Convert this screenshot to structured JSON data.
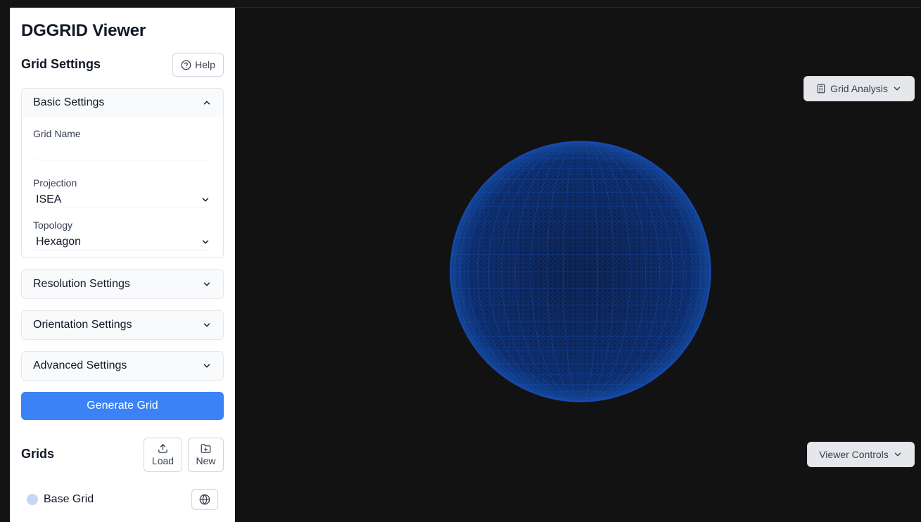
{
  "app": {
    "title": "DGGRID Viewer"
  },
  "grid_settings": {
    "title": "Grid Settings",
    "help_label": "Help",
    "panels": {
      "basic": {
        "label": "Basic Settings",
        "grid_name": {
          "label": "Grid Name",
          "value": "",
          "placeholder": ""
        },
        "projection": {
          "label": "Projection",
          "value": "ISEA"
        },
        "topology": {
          "label": "Topology",
          "value": "Hexagon"
        }
      },
      "resolution": {
        "label": "Resolution Settings"
      },
      "orientation": {
        "label": "Orientation Settings"
      },
      "advanced": {
        "label": "Advanced Settings"
      }
    },
    "generate_label": "Generate Grid"
  },
  "grids": {
    "title": "Grids",
    "load_label": "Load",
    "new_label": "New",
    "items": [
      {
        "name": "Base Grid",
        "color": "#c7d6f6"
      }
    ]
  },
  "viewer": {
    "grid_analysis_label": "Grid Analysis",
    "viewer_controls_label": "Viewer Controls",
    "globe_color": "#0d3a8c"
  },
  "icons": [
    "help-circle-icon",
    "chevron-up-icon",
    "chevron-down-icon",
    "upload-icon",
    "folder-plus-icon",
    "globe-icon",
    "calculator-icon"
  ]
}
